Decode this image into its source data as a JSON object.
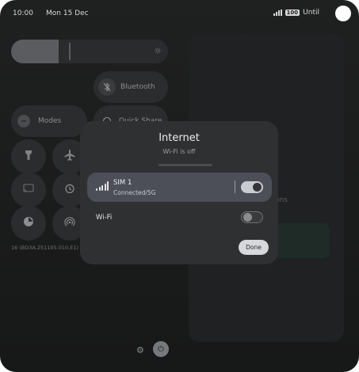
{
  "status_bar": {
    "time": "10:00",
    "date": "Mon 15 Dec",
    "battery": "100",
    "network_label": "Until"
  },
  "quick_settings": {
    "bluetooth_label": "Bluetooth",
    "modes_label": "Modes",
    "quick_share_label": "Quick Share",
    "build_number": "16 (BD3A.251105.010.E1)",
    "background_text": "ons"
  },
  "dialog": {
    "title": "Internet",
    "subtitle": "Wi-Fi is off",
    "sim": {
      "name": "SIM 1",
      "status": "Connected/5G",
      "enabled": true
    },
    "wifi": {
      "label": "Wi-Fi",
      "enabled": false
    },
    "done_label": "Done"
  },
  "icons": {
    "bluetooth": "bluetooth-off-icon",
    "modes": "modes-icon",
    "flashlight": "flashlight-icon",
    "airplane": "airplane-icon",
    "cast": "cast-icon",
    "alarm": "alarm-icon",
    "data_saver": "data-saver-icon",
    "hotspot": "hotspot-icon",
    "settings": "gear-icon",
    "power": "power-icon"
  }
}
